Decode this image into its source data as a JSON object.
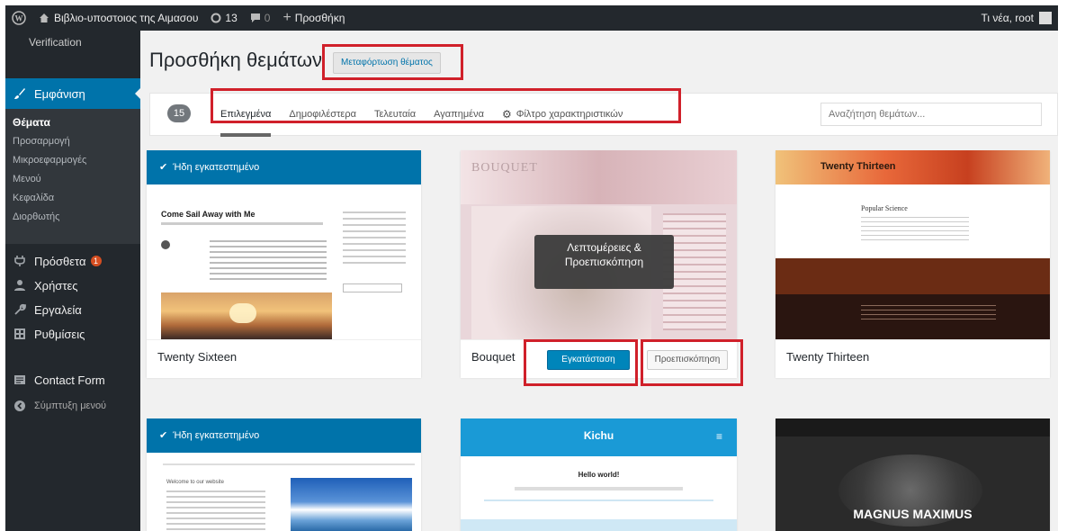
{
  "adminbar": {
    "site_name": "Βιβλιο-υποστοιος της Αιμασου",
    "updates_count": "13",
    "comments_count": "0",
    "new_label": "Προσθήκη",
    "howdy": "Τι νέα, root"
  },
  "sidebar": {
    "top_label": "Verification",
    "active": "Εμφάνιση",
    "submenu": [
      "Θέματα",
      "Προσαρμογή",
      "Μικροεφαρμογές",
      "Μενού",
      "Κεφαλίδα",
      "Διορθωτής"
    ],
    "items": [
      {
        "label": "Πρόσθετα",
        "badge": "1"
      },
      {
        "label": "Χρήστες"
      },
      {
        "label": "Εργαλεία"
      },
      {
        "label": "Ρυθμίσεις"
      },
      {
        "label": "Contact Form"
      },
      {
        "label": "Σύμπτυξη μενού"
      }
    ]
  },
  "main": {
    "title": "Προσθήκη θεμάτων",
    "upload_button": "Μεταφόρτωση θέματος",
    "theme_count": "15",
    "tabs": [
      "Επιλεγμένα",
      "Δημοφιλέστερα",
      "Τελευταία",
      "Αγαπημένα"
    ],
    "feature_filter": "Φίλτρο χαρακτηριστικών",
    "search_placeholder": "Αναζήτηση θεμάτων..."
  },
  "themes": [
    {
      "name": "Twenty Sixteen",
      "installed_label": "Ήδη εγκατεστημένο",
      "preview_title": "Come Sail Away with Me"
    },
    {
      "name": "Bouquet",
      "install_button": "Εγκατάσταση",
      "preview_button": "Προεπισκόπηση",
      "tooltip": "Λεπτομέρειες & Προεπισκόπηση",
      "preview_title": "BOUQUET"
    },
    {
      "name": "Twenty Thirteen",
      "preview_title": "Twenty Thirteen",
      "preview_subtitle": "Popular Science"
    },
    {
      "installed_label": "Ήδη εγκατεστημένο",
      "preview_title": "Welcome to our website"
    },
    {
      "preview_title": "Kichu",
      "preview_subtitle": "Hello world!"
    },
    {
      "preview_title": "MAGNUS MAXIMUS"
    }
  ],
  "colors": {
    "accent": "#0073aa",
    "highlight": "#d0202a",
    "adminbar": "#23282d"
  }
}
